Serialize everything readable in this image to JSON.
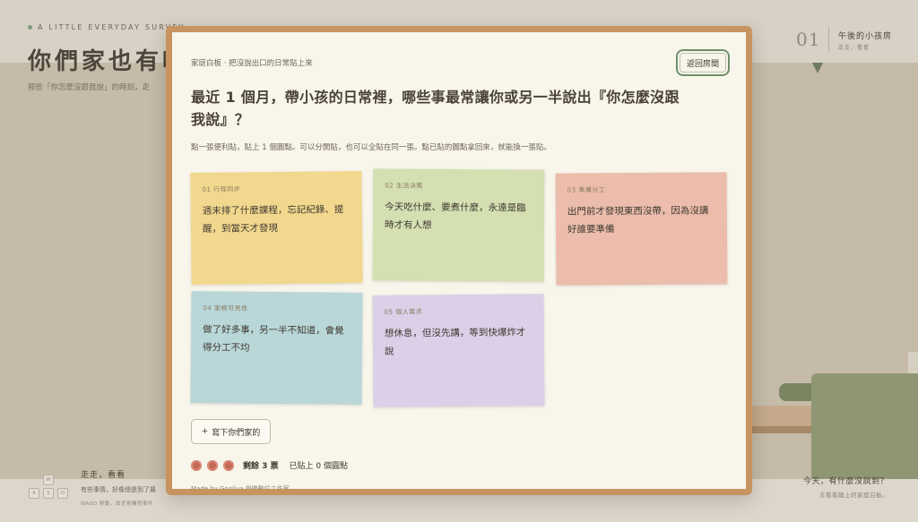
{
  "colors": {
    "frame": "#c79460",
    "modal_bg": "#f8f5ea",
    "accent_green": "#6f8f6a",
    "dot_red": "#c26a57",
    "note_yellow": "#f2d88e",
    "note_green": "#d4dfb2",
    "note_pink": "#ecbdac",
    "note_blue": "#b9d7d9",
    "note_purple": "#dccfe8"
  },
  "background": {
    "eyebrow": "A LITTLE EVERYDAY SURVEY",
    "title": "你們家也有哪",
    "subtitle": "那些「你怎麼沒跟我說」的時刻，走",
    "room": {
      "number": "01",
      "name": "午後的小孩房",
      "hint": "走走，看看"
    },
    "walk": {
      "title": "走走，看看",
      "desc": "有些事情，好像總是到了最",
      "keys_hint": "WASD 移動，靠近會觸發事件",
      "keys": [
        "W",
        "A",
        "S",
        "D"
      ]
    },
    "prompt": {
      "question": "今天，有什麼沒說到？",
      "sub": "去看看牆上的家庭白板。"
    }
  },
  "modal": {
    "breadcrumb": "家庭白板 · 把沒說出口的日常貼上來",
    "back_button": "返回房間",
    "question": "最近 1 個月，帶小孩的日常裡，哪些事最常讓你或另一半說出『你怎麼沒跟我說』？",
    "instructions": "點一張便利貼，貼上 1 個圓點。可以分開貼，也可以全貼在同一張。點已貼的圓點拿回來，就能換一張貼。",
    "notes": [
      {
        "tag": "01 行程同步",
        "text": "週末排了什麼課程，忘記紀錄、提醒，到當天才發現",
        "color": "#f2d88e"
      },
      {
        "tag": "02 生活決策",
        "text": "今天吃什麼、要煮什麼，永遠是臨時才有人想",
        "color": "#d4dfb2"
      },
      {
        "tag": "03 準備分工",
        "text": "出門前才發現東西沒帶，因為沒講好誰要準備",
        "color": "#ecbdac"
      },
      {
        "tag": "04 家務可見性",
        "text": "做了好多事，另一半不知道，會覺得分工不均",
        "color": "#b9d7d9"
      },
      {
        "tag": "05 個人需求",
        "text": "想休息，但沒先講，等到快爆炸才說",
        "color": "#dccfe8"
      }
    ],
    "add_button": "寫下你們家的",
    "add_icon": "plus-icon",
    "dots_count": 3,
    "remaining": "剩餘 3 票",
    "placed": "已貼上 0 個圓點",
    "made_by": "Made by Gooliva 與機數位工作室"
  }
}
